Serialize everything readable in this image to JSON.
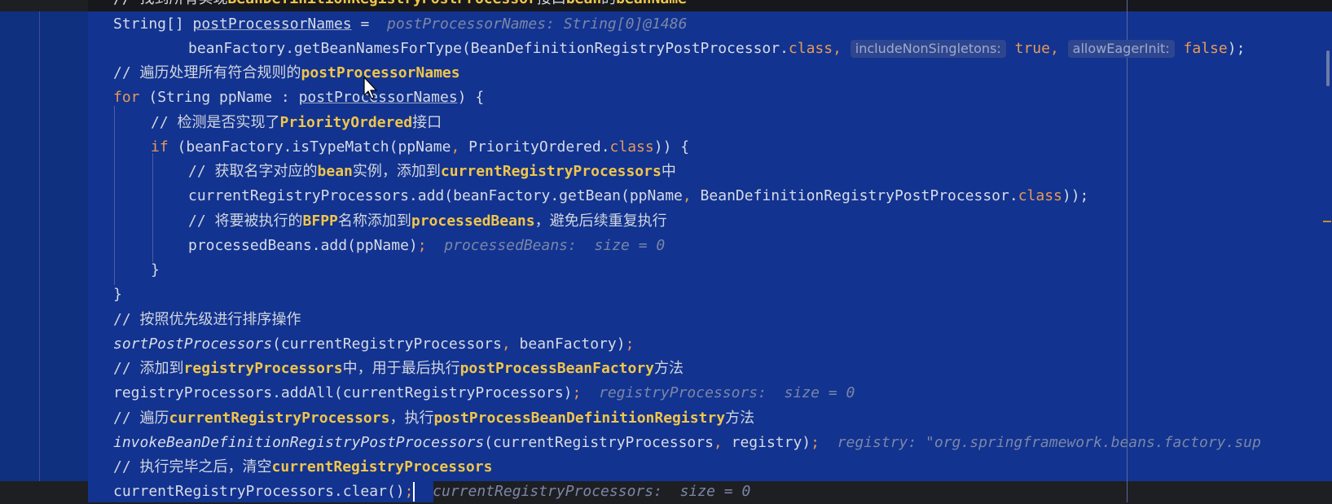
{
  "lines": {
    "l0": {
      "comment": "// 找到所有实现",
      "ctext": "BeanDefinitionRegistryPostProcessor",
      "comment2": "接口",
      "ctext2": "bean",
      "comment3": "的",
      "ctext3": "beanName"
    },
    "l1": {
      "code": "String[] ",
      "var": "postProcessorNames",
      "code2": " = ",
      "hint": "postProcessorNames: String[0]@1486"
    },
    "l2": {
      "code": "beanFactory.getBeanNamesForType(BeanDefinitionRegistryPostProcessor.",
      "kw": "class",
      "punc": ",",
      "p1": "includeNonSingletons:",
      "v1": "true",
      "punc2": ",",
      "p2": "allowEagerInit:",
      "v2": "false",
      "end": ");"
    },
    "l3": {
      "comment": "// 遍历处理所有符合规则的",
      "ctext": "postProcessorNames"
    },
    "l4": {
      "kw": "for",
      "code": " (String ppName : ",
      "var": "postProcessorNames",
      "code2": ") {"
    },
    "l5": {
      "comment": "// 检测是否实现了",
      "ctext": "PriorityOrdered",
      "comment2": "接口"
    },
    "l6": {
      "kw": "if",
      "code": " (beanFactory.isTypeMatch(ppName",
      "punc": ",",
      "code2": " PriorityOrdered.",
      "kw2": "class",
      "code3": ")) {"
    },
    "l7": {
      "comment": "// 获取名字对应的",
      "ctext": "bean",
      "comment2": "实例，添加到",
      "ctext2": "currentRegistryProcessors",
      "comment3": "中"
    },
    "l8": {
      "code": "currentRegistryProcessors.add(beanFactory.getBean(ppName",
      "punc": ",",
      "code2": " BeanDefinitionRegistryPostProcessor.",
      "kw": "class",
      "code3": "));"
    },
    "l9": {
      "comment": "// 将要被执行的",
      "ctext": "BFPP",
      "comment2": "名称添加到",
      "ctext2": "processedBeans",
      "comment3": "，避免后续重复执行"
    },
    "l10": {
      "code": "processedBeans.add(ppName)",
      "punc": ";",
      "hint": "processedBeans:  size = 0"
    },
    "l11": {
      "code": "}"
    },
    "l12": {
      "code": "}"
    },
    "l13": {
      "comment": "// 按照优先级进行排序操作"
    },
    "l14": {
      "code": "sortPostProcessors",
      "code2": "(currentRegistryProcessors",
      "punc": ",",
      "code3": " beanFactory)",
      "punc2": ";"
    },
    "l15": {
      "comment": "// 添加到",
      "ctext": "registryProcessors",
      "comment2": "中，用于最后执行",
      "ctext2": "postProcessBeanFactory",
      "comment3": "方法"
    },
    "l16": {
      "code": "registryProcessors.addAll(currentRegistryProcessors)",
      "punc": ";",
      "hint": "registryProcessors:  size = 0"
    },
    "l17": {
      "comment": "// 遍历",
      "ctext": "currentRegistryProcessors",
      "comment2": "，执行",
      "ctext2": "postProcessBeanDefinitionRegistry",
      "comment3": "方法"
    },
    "l18": {
      "code": "invokeBeanDefinitionRegistryPostProcessors",
      "code2": "(currentRegistryProcessors",
      "punc": ",",
      "code3": " registry)",
      "punc2": ";",
      "hint": "registry: \"org.springframework.beans.factory.sup"
    },
    "l19": {
      "comment": "// 执行完毕之后，清空",
      "ctext": "currentRegistryProcessors"
    },
    "l20": {
      "code": "currentRegistryProcessors.clear()",
      "punc": ";",
      "hint": "currentRegistryProcessors:  size = 0"
    }
  },
  "colors": {
    "selection": "#12338f",
    "keyword": "#e69a5a",
    "comment_highlight": "#f0c54b",
    "background": "#1e1f22"
  }
}
